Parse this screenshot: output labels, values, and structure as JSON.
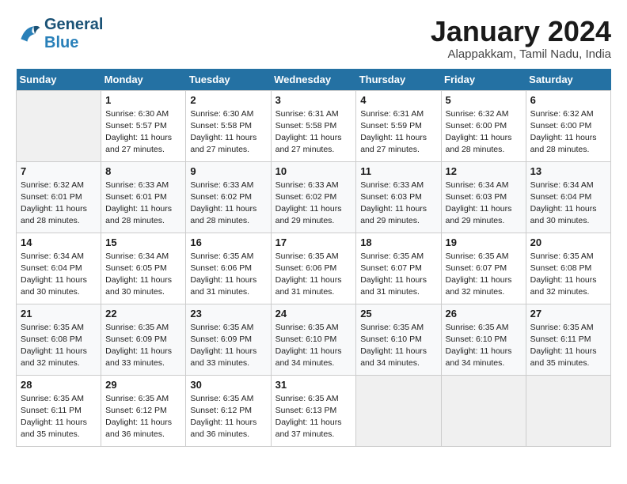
{
  "header": {
    "logo_line1": "General",
    "logo_line2": "Blue",
    "month_title": "January 2024",
    "location": "Alappakkam, Tamil Nadu, India"
  },
  "days_of_week": [
    "Sunday",
    "Monday",
    "Tuesday",
    "Wednesday",
    "Thursday",
    "Friday",
    "Saturday"
  ],
  "weeks": [
    [
      {
        "day": "",
        "info": ""
      },
      {
        "day": "1",
        "info": "Sunrise: 6:30 AM\nSunset: 5:57 PM\nDaylight: 11 hours\nand 27 minutes."
      },
      {
        "day": "2",
        "info": "Sunrise: 6:30 AM\nSunset: 5:58 PM\nDaylight: 11 hours\nand 27 minutes."
      },
      {
        "day": "3",
        "info": "Sunrise: 6:31 AM\nSunset: 5:58 PM\nDaylight: 11 hours\nand 27 minutes."
      },
      {
        "day": "4",
        "info": "Sunrise: 6:31 AM\nSunset: 5:59 PM\nDaylight: 11 hours\nand 27 minutes."
      },
      {
        "day": "5",
        "info": "Sunrise: 6:32 AM\nSunset: 6:00 PM\nDaylight: 11 hours\nand 28 minutes."
      },
      {
        "day": "6",
        "info": "Sunrise: 6:32 AM\nSunset: 6:00 PM\nDaylight: 11 hours\nand 28 minutes."
      }
    ],
    [
      {
        "day": "7",
        "info": "Sunrise: 6:32 AM\nSunset: 6:01 PM\nDaylight: 11 hours\nand 28 minutes."
      },
      {
        "day": "8",
        "info": "Sunrise: 6:33 AM\nSunset: 6:01 PM\nDaylight: 11 hours\nand 28 minutes."
      },
      {
        "day": "9",
        "info": "Sunrise: 6:33 AM\nSunset: 6:02 PM\nDaylight: 11 hours\nand 28 minutes."
      },
      {
        "day": "10",
        "info": "Sunrise: 6:33 AM\nSunset: 6:02 PM\nDaylight: 11 hours\nand 29 minutes."
      },
      {
        "day": "11",
        "info": "Sunrise: 6:33 AM\nSunset: 6:03 PM\nDaylight: 11 hours\nand 29 minutes."
      },
      {
        "day": "12",
        "info": "Sunrise: 6:34 AM\nSunset: 6:03 PM\nDaylight: 11 hours\nand 29 minutes."
      },
      {
        "day": "13",
        "info": "Sunrise: 6:34 AM\nSunset: 6:04 PM\nDaylight: 11 hours\nand 30 minutes."
      }
    ],
    [
      {
        "day": "14",
        "info": "Sunrise: 6:34 AM\nSunset: 6:04 PM\nDaylight: 11 hours\nand 30 minutes."
      },
      {
        "day": "15",
        "info": "Sunrise: 6:34 AM\nSunset: 6:05 PM\nDaylight: 11 hours\nand 30 minutes."
      },
      {
        "day": "16",
        "info": "Sunrise: 6:35 AM\nSunset: 6:06 PM\nDaylight: 11 hours\nand 31 minutes."
      },
      {
        "day": "17",
        "info": "Sunrise: 6:35 AM\nSunset: 6:06 PM\nDaylight: 11 hours\nand 31 minutes."
      },
      {
        "day": "18",
        "info": "Sunrise: 6:35 AM\nSunset: 6:07 PM\nDaylight: 11 hours\nand 31 minutes."
      },
      {
        "day": "19",
        "info": "Sunrise: 6:35 AM\nSunset: 6:07 PM\nDaylight: 11 hours\nand 32 minutes."
      },
      {
        "day": "20",
        "info": "Sunrise: 6:35 AM\nSunset: 6:08 PM\nDaylight: 11 hours\nand 32 minutes."
      }
    ],
    [
      {
        "day": "21",
        "info": "Sunrise: 6:35 AM\nSunset: 6:08 PM\nDaylight: 11 hours\nand 32 minutes."
      },
      {
        "day": "22",
        "info": "Sunrise: 6:35 AM\nSunset: 6:09 PM\nDaylight: 11 hours\nand 33 minutes."
      },
      {
        "day": "23",
        "info": "Sunrise: 6:35 AM\nSunset: 6:09 PM\nDaylight: 11 hours\nand 33 minutes."
      },
      {
        "day": "24",
        "info": "Sunrise: 6:35 AM\nSunset: 6:10 PM\nDaylight: 11 hours\nand 34 minutes."
      },
      {
        "day": "25",
        "info": "Sunrise: 6:35 AM\nSunset: 6:10 PM\nDaylight: 11 hours\nand 34 minutes."
      },
      {
        "day": "26",
        "info": "Sunrise: 6:35 AM\nSunset: 6:10 PM\nDaylight: 11 hours\nand 34 minutes."
      },
      {
        "day": "27",
        "info": "Sunrise: 6:35 AM\nSunset: 6:11 PM\nDaylight: 11 hours\nand 35 minutes."
      }
    ],
    [
      {
        "day": "28",
        "info": "Sunrise: 6:35 AM\nSunset: 6:11 PM\nDaylight: 11 hours\nand 35 minutes."
      },
      {
        "day": "29",
        "info": "Sunrise: 6:35 AM\nSunset: 6:12 PM\nDaylight: 11 hours\nand 36 minutes."
      },
      {
        "day": "30",
        "info": "Sunrise: 6:35 AM\nSunset: 6:12 PM\nDaylight: 11 hours\nand 36 minutes."
      },
      {
        "day": "31",
        "info": "Sunrise: 6:35 AM\nSunset: 6:13 PM\nDaylight: 11 hours\nand 37 minutes."
      },
      {
        "day": "",
        "info": ""
      },
      {
        "day": "",
        "info": ""
      },
      {
        "day": "",
        "info": ""
      }
    ]
  ]
}
